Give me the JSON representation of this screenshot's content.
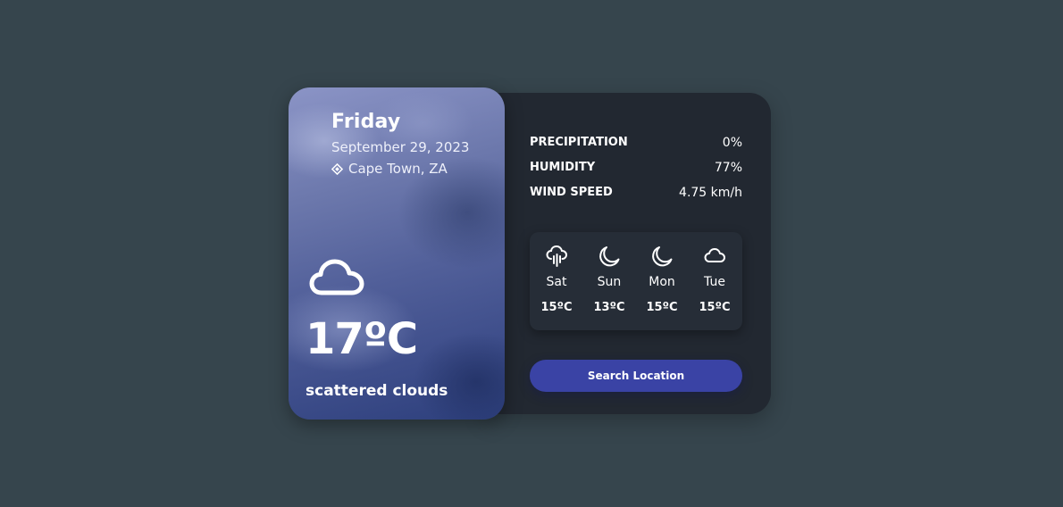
{
  "today": {
    "day": "Friday",
    "date": "September 29, 2023",
    "location": "Cape Town, ZA",
    "location_icon": "location-pin-icon",
    "icon": "cloud-icon",
    "temperature": "17ºC",
    "description": "scattered clouds"
  },
  "stats": [
    {
      "label": "PRECIPITATION",
      "value": "0%"
    },
    {
      "label": "HUMIDITY",
      "value": "77%"
    },
    {
      "label": "WIND SPEED",
      "value": "4.75 km/h"
    }
  ],
  "forecast": [
    {
      "day": "Sat",
      "temp": "15ºC",
      "icon": "cloud-rain-icon"
    },
    {
      "day": "Sun",
      "temp": "13ºC",
      "icon": "moon-icon"
    },
    {
      "day": "Mon",
      "temp": "15ºC",
      "icon": "moon-icon"
    },
    {
      "day": "Tue",
      "temp": "15ºC",
      "icon": "cloud-icon"
    }
  ],
  "search_button": {
    "label": "Search Location"
  },
  "colors": {
    "background": "#36454d",
    "panel": "#222831",
    "forecast_box": "#262d37",
    "button": "#3a43a5",
    "text": "#ffffff"
  }
}
